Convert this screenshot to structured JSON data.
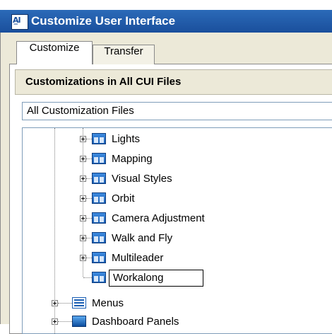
{
  "window": {
    "title": "Customize User Interface"
  },
  "tabs": [
    {
      "label": "Customize",
      "active": true
    },
    {
      "label": "Transfer",
      "active": false
    }
  ],
  "section": {
    "header": "Customizations in All CUI Files"
  },
  "filter": {
    "selected": "All Customization Files"
  },
  "tree": {
    "toolbar_items": [
      {
        "label": "Lights",
        "expandable": true
      },
      {
        "label": "Mapping",
        "expandable": true
      },
      {
        "label": "Visual Styles",
        "expandable": true
      },
      {
        "label": "Orbit",
        "expandable": true
      },
      {
        "label": "Camera Adjustment",
        "expandable": true
      },
      {
        "label": "Walk and Fly",
        "expandable": true
      },
      {
        "label": "Multileader",
        "expandable": true
      },
      {
        "label": "Workalong",
        "expandable": false,
        "editing": true
      }
    ],
    "top_items": [
      {
        "label": "Menus",
        "icon": "menu-icon"
      },
      {
        "label": "Dashboard Panels",
        "icon": "dashboard-panel-icon"
      }
    ]
  },
  "colors": {
    "titlebar": "#1a4f9c",
    "window_bg": "#ece9d8",
    "icon_blue": "#1a5fb4"
  }
}
